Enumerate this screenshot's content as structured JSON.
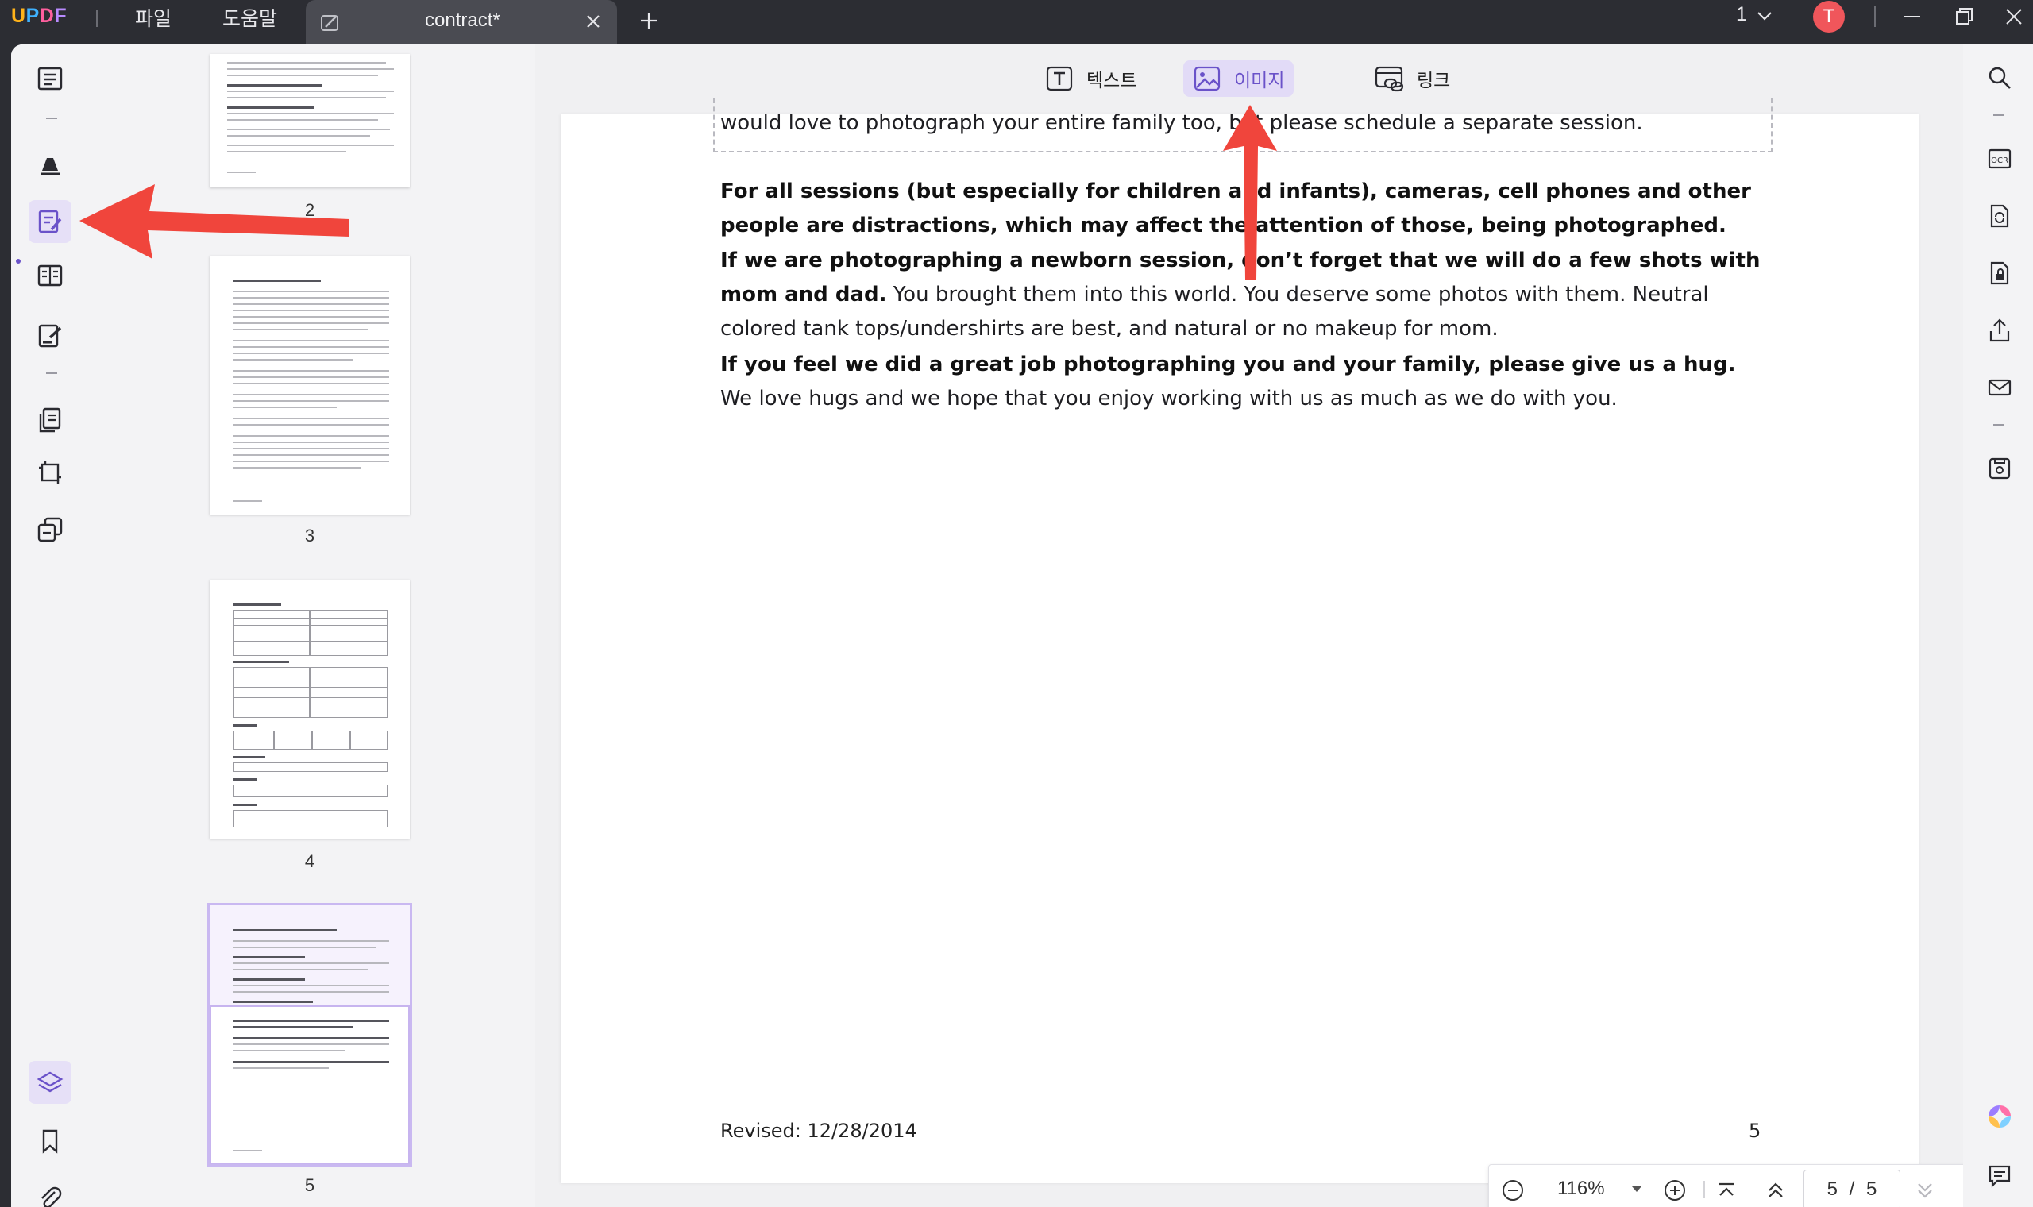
{
  "app": {
    "logo": "UPDF"
  },
  "menu": {
    "file": "파일",
    "help": "도움말"
  },
  "tab": {
    "title": "contract*"
  },
  "titlebar": {
    "page_selector": "1",
    "avatar_letter": "T"
  },
  "thumbnails": [
    {
      "number": "2"
    },
    {
      "number": "3"
    },
    {
      "number": "4"
    },
    {
      "number": "5"
    }
  ],
  "edit_toolbar": {
    "text": "텍스트",
    "image": "이미지",
    "link": "링크",
    "active": "image"
  },
  "document": {
    "line_top": "would love to photograph your entire family too, but please schedule a separate session.",
    "para1_bold": "For all sessions (but especially for children and infants), cameras, cell phones and other people are distractions, which may affect the attention of those, being photographed.",
    "para2_bold": "If we are photographing a newborn session, don’t forget that we will do a few shots with mom and dad.",
    "para2_rest": " You brought them into this world. You deserve some photos with them. Neutral colored tank tops/undershirts are best, and natural or no makeup for mom.",
    "para3_bold": "If you feel we did a great job photographing you and your family, please give us a hug.",
    "para3_rest": " We love hugs and we hope that you enjoy working with us as much as we do with you.",
    "footer_left": "Revised: 12/28/2014",
    "footer_right": "5"
  },
  "zoom": {
    "level": "116%",
    "current_page": "5",
    "separator": "/",
    "total_pages": "5"
  },
  "colors": {
    "accent": "#6a52c9",
    "annotation_arrow": "#f0453c",
    "titlebar": "#2c2d33"
  }
}
